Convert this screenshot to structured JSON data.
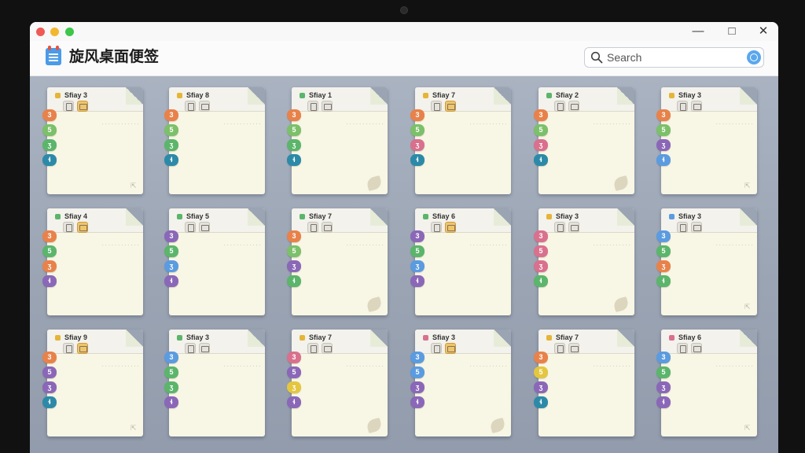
{
  "window": {
    "app_title": "旋风桌面便签",
    "search": {
      "placeholder": "Search",
      "value": ""
    },
    "controls": {
      "minimize": "—",
      "maximize": "□",
      "close": "✕"
    }
  },
  "colors": {
    "tab_orange": "#e8824a",
    "tab_green": "#7cc06a",
    "tab_teal": "#2c8aa8",
    "tab_purple": "#8b67b8",
    "tab_pink": "#d9708e",
    "tab_blue": "#5b9be0",
    "tab_yellow": "#e4c63f",
    "tab_lime": "#9ac84c"
  },
  "icons": [
    "search-icon",
    "calendar-app-icon",
    "note-edit-icon",
    "note-image-icon",
    "leaf-icon",
    "resize-icon"
  ],
  "notes": [
    {
      "title": "Sfiay 3",
      "dot": "#e6b437",
      "tabs": [
        {
          "t": "3",
          "c": "#e8824a"
        },
        {
          "t": "5",
          "c": "#7cc06a"
        },
        {
          "t": "ʒ",
          "c": "#5bb56b"
        },
        {
          "t": "ɬ",
          "c": "#2c8aa8"
        }
      ],
      "corner": "arrow"
    },
    {
      "title": "Sfiay 8",
      "dot": "#e6b437",
      "tabs": [
        {
          "t": "3",
          "c": "#e8824a"
        },
        {
          "t": "5",
          "c": "#7cc06a"
        },
        {
          "t": "ʒ",
          "c": "#5bb56b"
        },
        {
          "t": "ɬ",
          "c": "#2c8aa8"
        }
      ],
      "corner": "none"
    },
    {
      "title": "Sfiay 1",
      "dot": "#5bb56b",
      "tabs": [
        {
          "t": "3",
          "c": "#e8824a"
        },
        {
          "t": "5",
          "c": "#7cc06a"
        },
        {
          "t": "ʒ",
          "c": "#5bb56b"
        },
        {
          "t": "ɬ",
          "c": "#2c8aa8"
        }
      ],
      "corner": "leaf"
    },
    {
      "title": "Sfiay 7",
      "dot": "#e6b437",
      "tabs": [
        {
          "t": "3",
          "c": "#e8824a"
        },
        {
          "t": "5",
          "c": "#7cc06a"
        },
        {
          "t": "ʒ",
          "c": "#d9708e"
        },
        {
          "t": "ɬ",
          "c": "#2c8aa8"
        }
      ],
      "corner": "none"
    },
    {
      "title": "Sfiay 2",
      "dot": "#5bb56b",
      "tabs": [
        {
          "t": "3",
          "c": "#e8824a"
        },
        {
          "t": "5",
          "c": "#7cc06a"
        },
        {
          "t": "ʒ",
          "c": "#d9708e"
        },
        {
          "t": "ɬ",
          "c": "#2c8aa8"
        }
      ],
      "corner": "leaf"
    },
    {
      "title": "Sfiay 3",
      "dot": "#e6b437",
      "tabs": [
        {
          "t": "3",
          "c": "#e8824a"
        },
        {
          "t": "5",
          "c": "#7cc06a"
        },
        {
          "t": "ʒ",
          "c": "#8b67b8"
        },
        {
          "t": "ɬ",
          "c": "#5b9be0"
        }
      ],
      "corner": "arrow"
    },
    {
      "title": "Sfiay 4",
      "dot": "#5bb56b",
      "tabs": [
        {
          "t": "3",
          "c": "#e8824a"
        },
        {
          "t": "5",
          "c": "#5bb56b"
        },
        {
          "t": "ʒ",
          "c": "#e8824a"
        },
        {
          "t": "ɬ",
          "c": "#8b67b8"
        }
      ],
      "corner": "none"
    },
    {
      "title": "Sfiay 5",
      "dot": "#5bb56b",
      "tabs": [
        {
          "t": "3",
          "c": "#8b67b8"
        },
        {
          "t": "5",
          "c": "#5bb56b"
        },
        {
          "t": "ʒ",
          "c": "#5b9be0"
        },
        {
          "t": "ɬ",
          "c": "#8b67b8"
        }
      ],
      "corner": "none"
    },
    {
      "title": "Sfiay 7",
      "dot": "#5bb56b",
      "tabs": [
        {
          "t": "3",
          "c": "#e8824a"
        },
        {
          "t": "5",
          "c": "#7cc06a"
        },
        {
          "t": "ʒ",
          "c": "#8b67b8"
        },
        {
          "t": "ɬ",
          "c": "#5bb56b"
        }
      ],
      "corner": "leaf"
    },
    {
      "title": "Sfiay 6",
      "dot": "#5bb56b",
      "tabs": [
        {
          "t": "3",
          "c": "#8b67b8"
        },
        {
          "t": "5",
          "c": "#5bb56b"
        },
        {
          "t": "ʒ",
          "c": "#5b9be0"
        },
        {
          "t": "ɬ",
          "c": "#8b67b8"
        }
      ],
      "corner": "none"
    },
    {
      "title": "Sfiay 3",
      "dot": "#e6b437",
      "tabs": [
        {
          "t": "3",
          "c": "#d9708e"
        },
        {
          "t": "5",
          "c": "#d9708e"
        },
        {
          "t": "ʒ",
          "c": "#d9708e"
        },
        {
          "t": "ɬ",
          "c": "#5bb56b"
        }
      ],
      "corner": "leaf"
    },
    {
      "title": "Sfiay 3",
      "dot": "#5b9be0",
      "tabs": [
        {
          "t": "3",
          "c": "#5b9be0"
        },
        {
          "t": "5",
          "c": "#5bb56b"
        },
        {
          "t": "ʒ",
          "c": "#e8824a"
        },
        {
          "t": "ɬ",
          "c": "#5bb56b"
        }
      ],
      "corner": "arrow"
    },
    {
      "title": "Sfiay 9",
      "dot": "#e6b437",
      "tabs": [
        {
          "t": "3",
          "c": "#e8824a"
        },
        {
          "t": "5",
          "c": "#8b67b8"
        },
        {
          "t": "ʒ",
          "c": "#8b67b8"
        },
        {
          "t": "ɬ",
          "c": "#2c8aa8"
        }
      ],
      "corner": "arrow"
    },
    {
      "title": "Sfiay 3",
      "dot": "#5bb56b",
      "tabs": [
        {
          "t": "3",
          "c": "#5b9be0"
        },
        {
          "t": "5",
          "c": "#5bb56b"
        },
        {
          "t": "ʒ",
          "c": "#5bb56b"
        },
        {
          "t": "ɬ",
          "c": "#8b67b8"
        }
      ],
      "corner": "none"
    },
    {
      "title": "Sfiay 7",
      "dot": "#e6b437",
      "tabs": [
        {
          "t": "3",
          "c": "#d9708e"
        },
        {
          "t": "5",
          "c": "#8b67b8"
        },
        {
          "t": "ʒ",
          "c": "#e4c63f"
        },
        {
          "t": "ɬ",
          "c": "#8b67b8"
        }
      ],
      "corner": "leaf"
    },
    {
      "title": "Sfiay 3",
      "dot": "#d9708e",
      "tabs": [
        {
          "t": "3",
          "c": "#5b9be0"
        },
        {
          "t": "5",
          "c": "#5b9be0"
        },
        {
          "t": "ʒ",
          "c": "#8b67b8"
        },
        {
          "t": "ɬ",
          "c": "#8b67b8"
        }
      ],
      "corner": "leaf"
    },
    {
      "title": "Sfiay 7",
      "dot": "#e6b437",
      "tabs": [
        {
          "t": "3",
          "c": "#e8824a"
        },
        {
          "t": "5",
          "c": "#e4c63f"
        },
        {
          "t": "ʒ",
          "c": "#8b67b8"
        },
        {
          "t": "ɬ",
          "c": "#2c8aa8"
        }
      ],
      "corner": "none"
    },
    {
      "title": "Sfiay 6",
      "dot": "#d9708e",
      "tabs": [
        {
          "t": "3",
          "c": "#5b9be0"
        },
        {
          "t": "5",
          "c": "#5bb56b"
        },
        {
          "t": "ʒ",
          "c": "#8b67b8"
        },
        {
          "t": "ɬ",
          "c": "#8b67b8"
        }
      ],
      "corner": "arrow"
    }
  ],
  "note_text": "· · · ·   ·  · · ·  · · · ·"
}
